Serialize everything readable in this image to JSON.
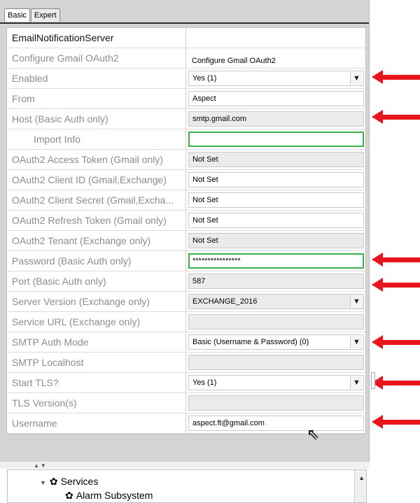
{
  "tabs": [
    {
      "label": "Basic"
    },
    {
      "label": "Expert"
    }
  ],
  "table": {
    "header": "EmailNotificationServer",
    "rows": [
      {
        "label": "Configure Gmail OAuth2",
        "value": "Configure Gmail OAuth2"
      },
      {
        "label": "Enabled",
        "value": "Yes (1)"
      },
      {
        "label": "From",
        "value": "Aspect"
      },
      {
        "label": "Host (Basic Auth only)",
        "value": "smtp.gmail.com"
      },
      {
        "label": "Import Info",
        "value": ""
      },
      {
        "label": "OAuth2 Access Token (Gmail only)",
        "value": "Not Set"
      },
      {
        "label": "OAuth2 Client ID (Gmail,Exchange)",
        "value": "Not Set"
      },
      {
        "label": "OAuth2 Client Secret (Gmail,Excha...",
        "value": "Not Set"
      },
      {
        "label": "OAuth2 Refresh Token (Gmail only)",
        "value": "Not Set"
      },
      {
        "label": "OAuth2 Tenant (Exchange only)",
        "value": "Not Set"
      },
      {
        "label": "Password (Basic Auth only)",
        "value": "****************"
      },
      {
        "label": "Port (Basic Auth only)",
        "value": "587"
      },
      {
        "label": "Server Version (Exchange only)",
        "value": "EXCHANGE_2016"
      },
      {
        "label": "Service URL (Exchange only)",
        "value": ""
      },
      {
        "label": "SMTP Auth Mode",
        "value": "Basic (Username & Password) (0)"
      },
      {
        "label": "SMTP Localhost",
        "value": ""
      },
      {
        "label": "Start TLS?",
        "value": "Yes (1)"
      },
      {
        "label": "TLS Version(s)",
        "value": ""
      },
      {
        "label": "Username",
        "value": "aspect.ft@gmail.com"
      }
    ]
  },
  "tree": {
    "items": [
      {
        "label": "Services"
      },
      {
        "label": "Alarm Subsystem"
      }
    ]
  },
  "icons": {
    "dropdown": "▼",
    "expander": "▼",
    "gear": "✿",
    "scroll_up": "▲",
    "cursor": "⇖"
  },
  "colors": {
    "arrow": "#e8161c",
    "focus_border": "#3bb54a"
  }
}
